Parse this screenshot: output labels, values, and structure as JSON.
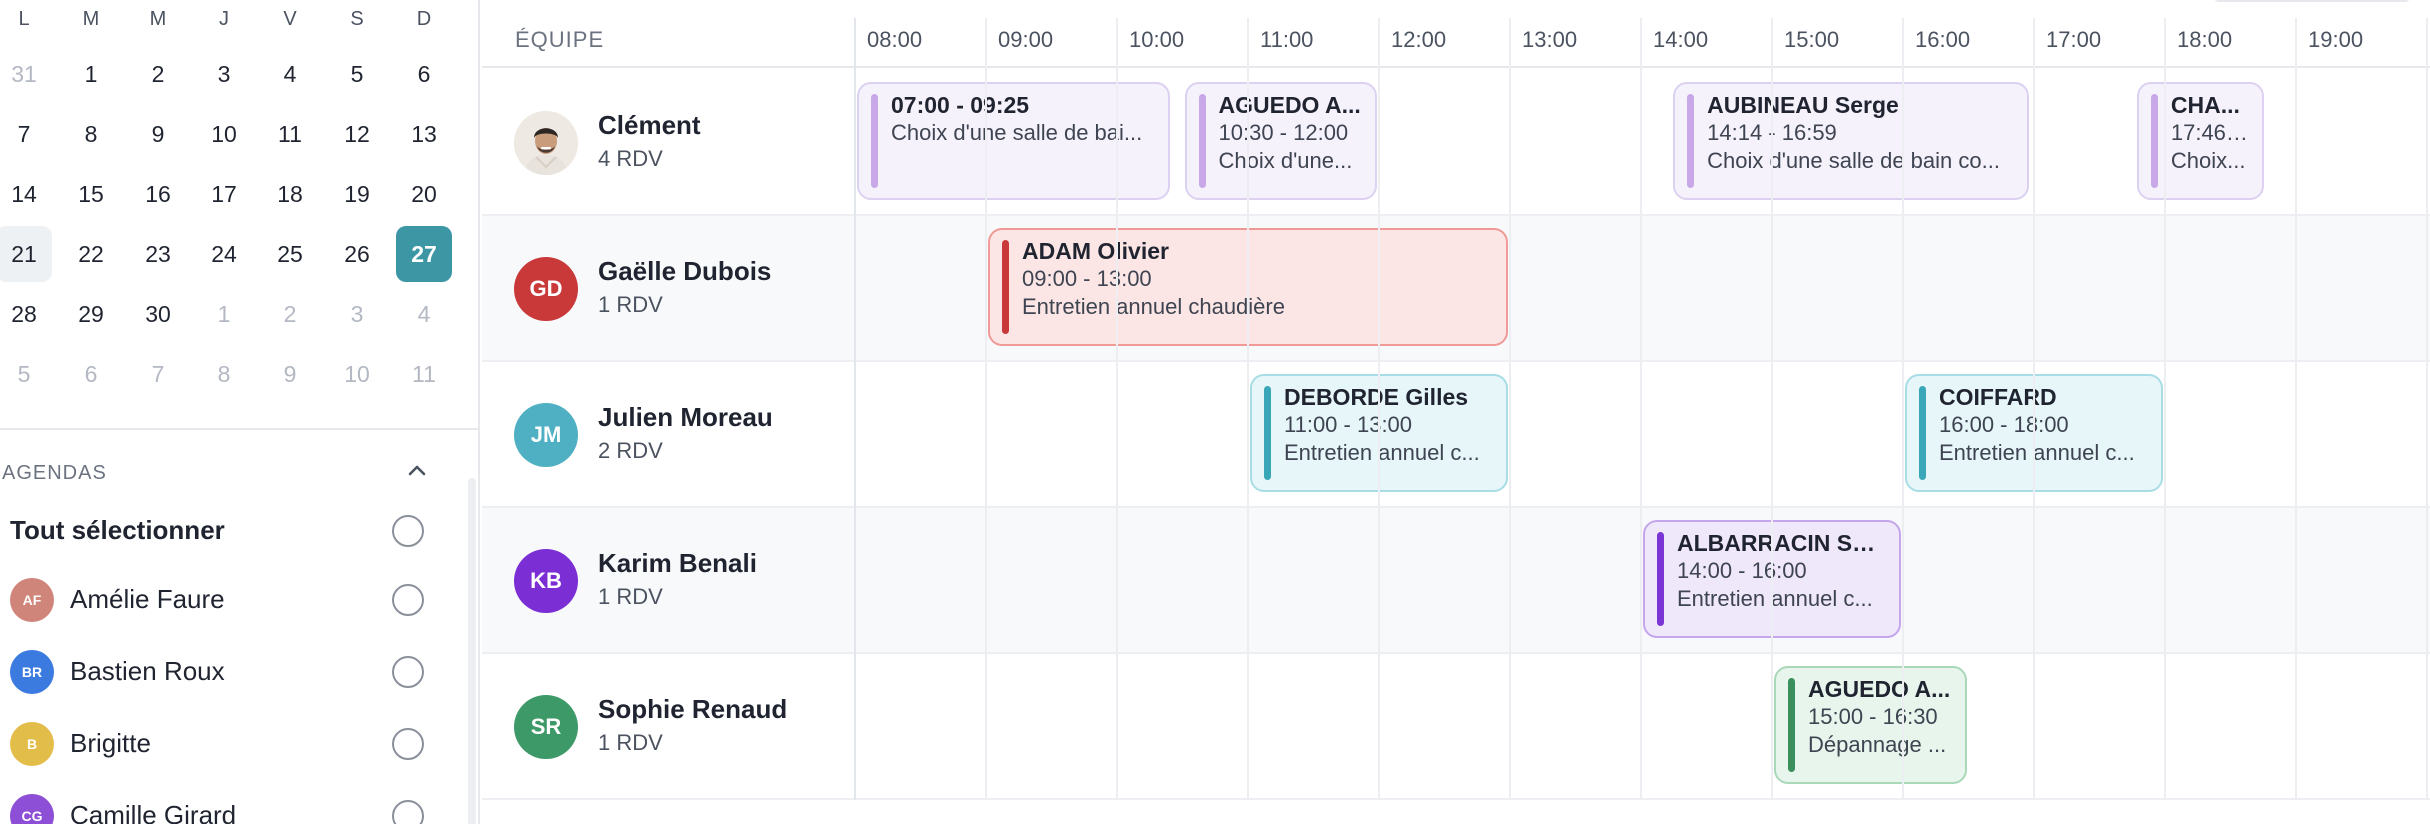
{
  "calendar": {
    "weekdays": [
      "L",
      "M",
      "M",
      "J",
      "V",
      "S",
      "D"
    ],
    "weeks": [
      [
        {
          "d": "31",
          "muted": true
        },
        {
          "d": "1"
        },
        {
          "d": "2"
        },
        {
          "d": "3"
        },
        {
          "d": "4"
        },
        {
          "d": "5"
        },
        {
          "d": "6"
        }
      ],
      [
        {
          "d": "7"
        },
        {
          "d": "8"
        },
        {
          "d": "9"
        },
        {
          "d": "10"
        },
        {
          "d": "11"
        },
        {
          "d": "12"
        },
        {
          "d": "13"
        }
      ],
      [
        {
          "d": "14"
        },
        {
          "d": "15"
        },
        {
          "d": "16"
        },
        {
          "d": "17"
        },
        {
          "d": "18"
        },
        {
          "d": "19"
        },
        {
          "d": "20"
        }
      ],
      [
        {
          "d": "21",
          "weekStart": true
        },
        {
          "d": "22"
        },
        {
          "d": "23"
        },
        {
          "d": "24"
        },
        {
          "d": "25"
        },
        {
          "d": "26"
        },
        {
          "d": "27",
          "selected": true
        }
      ],
      [
        {
          "d": "28"
        },
        {
          "d": "29"
        },
        {
          "d": "30"
        },
        {
          "d": "1",
          "muted": true
        },
        {
          "d": "2",
          "muted": true
        },
        {
          "d": "3",
          "muted": true
        },
        {
          "d": "4",
          "muted": true
        }
      ],
      [
        {
          "d": "5",
          "muted": true
        },
        {
          "d": "6",
          "muted": true
        },
        {
          "d": "7",
          "muted": true
        },
        {
          "d": "8",
          "muted": true
        },
        {
          "d": "9",
          "muted": true
        },
        {
          "d": "10",
          "muted": true
        },
        {
          "d": "11",
          "muted": true
        }
      ]
    ]
  },
  "agendas": {
    "title": "AGENDAS",
    "select_all": "Tout sélectionner",
    "items": [
      {
        "initials": "AF",
        "name": "Amélie Faure",
        "color": "#cf8579"
      },
      {
        "initials": "BR",
        "name": "Bastien Roux",
        "color": "#3b7be0"
      },
      {
        "initials": "B",
        "name": "Brigitte",
        "color": "#e3bd4a"
      },
      {
        "initials": "CG",
        "name": "Camille Girard",
        "color": "#8d4fd6"
      }
    ]
  },
  "schedule": {
    "team_label": "ÉQUIPE",
    "hours": [
      "08:00",
      "09:00",
      "10:00",
      "11:00",
      "12:00",
      "13:00",
      "14:00",
      "15:00",
      "16:00",
      "17:00",
      "18:00",
      "19:00"
    ],
    "members": [
      {
        "name": "Clément",
        "count": "4 RDV",
        "initials": "",
        "color": "#efe9e3",
        "photo": true,
        "appointments": [
          {
            "title": "07:00 - 09:25",
            "line2": "Choix d'une salle de bai...",
            "line3": "",
            "start": 8.0,
            "end": 10.42,
            "color": "lav"
          },
          {
            "title": "AGUEDO A...",
            "line2": "10:30 - 12:00",
            "line3": "Choix d'une...",
            "start": 10.5,
            "end": 12.0,
            "color": "lav"
          },
          {
            "title": "AUBINEAU Serge",
            "line2": "14:14 - 16:59",
            "line3": "Choix d'une salle de bain co...",
            "start": 14.23,
            "end": 16.98,
            "color": "lav"
          },
          {
            "title": "CHA...",
            "line2": "17:46 ...",
            "line3": "Choix...",
            "start": 17.77,
            "end": 18.77,
            "color": "lav"
          }
        ]
      },
      {
        "name": "Gaëlle Dubois",
        "count": "1 RDV",
        "initials": "GD",
        "color": "#c9393a",
        "appointments": [
          {
            "title": "ADAM Olivier",
            "line2": "09:00 - 13:00",
            "line3": "Entretien annuel chaudière",
            "start": 9.0,
            "end": 13.0,
            "color": "red"
          }
        ]
      },
      {
        "name": "Julien Moreau",
        "count": "2 RDV",
        "initials": "JM",
        "color": "#4fb0c3",
        "appointments": [
          {
            "title": "DEBORDE Gilles",
            "line2": "11:00 - 13:00",
            "line3": "Entretien annuel c...",
            "start": 11.0,
            "end": 13.0,
            "color": "cyan"
          },
          {
            "title": "COIFFARD",
            "line2": "16:00 - 18:00",
            "line3": "Entretien annuel c...",
            "start": 16.0,
            "end": 18.0,
            "color": "cyan"
          }
        ]
      },
      {
        "name": "Karim Benali",
        "count": "1 RDV",
        "initials": "KB",
        "color": "#7a2ed4",
        "appointments": [
          {
            "title": "ALBARRACIN Ser...",
            "line2": "14:00 - 16:00",
            "line3": "Entretien annuel c...",
            "start": 14.0,
            "end": 16.0,
            "color": "purple"
          }
        ]
      },
      {
        "name": "Sophie Renaud",
        "count": "1 RDV",
        "initials": "SR",
        "color": "#3d9a68",
        "appointments": [
          {
            "title": "AGUEDO A...",
            "line2": "15:00 - 16:30",
            "line3": "Dépannage ...",
            "start": 15.0,
            "end": 16.5,
            "color": "green"
          }
        ]
      }
    ]
  }
}
